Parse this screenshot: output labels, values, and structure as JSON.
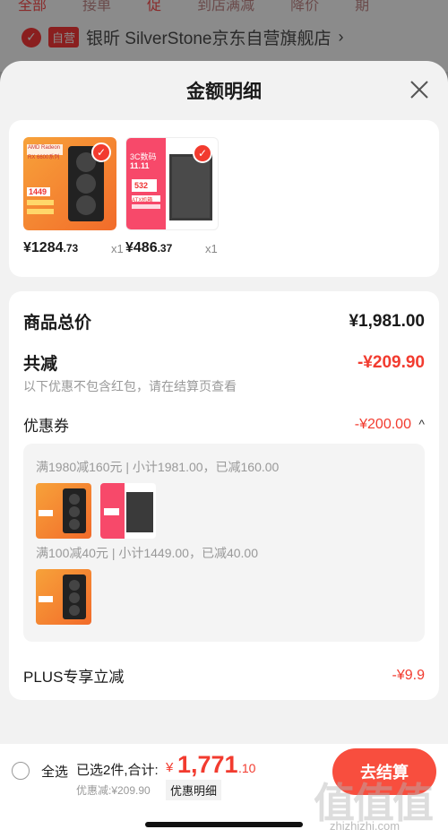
{
  "background": {
    "tabs": [
      "全部",
      "接单",
      "促",
      "到店满减",
      "降价",
      "期"
    ],
    "store_badge": "自营",
    "store_name": "银昕 SilverStone京东自营旗舰店",
    "chevron": "›"
  },
  "sheet": {
    "title": "金额明细",
    "close_icon": "close-icon"
  },
  "products": [
    {
      "price_main": "¥1284",
      "price_dec": ".73",
      "qty": "x1",
      "thumb_text": [
        "AMD Radeon",
        "RX 6600系列",
        "1449"
      ]
    },
    {
      "price_main": "¥486",
      "price_dec": ".37",
      "qty": "x1",
      "thumb_text": [
        "3C数码",
        "11.11",
        "532",
        "ATX机箱"
      ]
    }
  ],
  "summary": {
    "total_label": "商品总价",
    "total_value": "¥1,981.00",
    "reduce_label": "共减",
    "reduce_value": "-¥209.90",
    "hint": "以下优惠不包含红包，请在结算页查看",
    "coupon_label": "优惠券",
    "coupon_value": "-¥200.00",
    "coupon_toggle": "^",
    "coupon_rows": [
      "满1980减160元 | 小计1981.00，已减160.00",
      "满100减40元 | 小计1449.00，已减40.00"
    ],
    "plus_label": "PLUS专享立减",
    "plus_value": "-¥9.9"
  },
  "bottom": {
    "select_all": "全选",
    "selected": "已选2件,合计:",
    "currency": "¥",
    "total_int": "1,771",
    "total_dec": ".10",
    "discount": "优惠减:¥209.90",
    "detail": "优惠明细",
    "checkout": "去结算"
  },
  "watermark": {
    "text": "值值值",
    "url": "zhizhizhi.com"
  },
  "colors": {
    "accent": "#f23b2f",
    "checkout": "#f84e3e",
    "overlay": "#7a7a7a"
  }
}
